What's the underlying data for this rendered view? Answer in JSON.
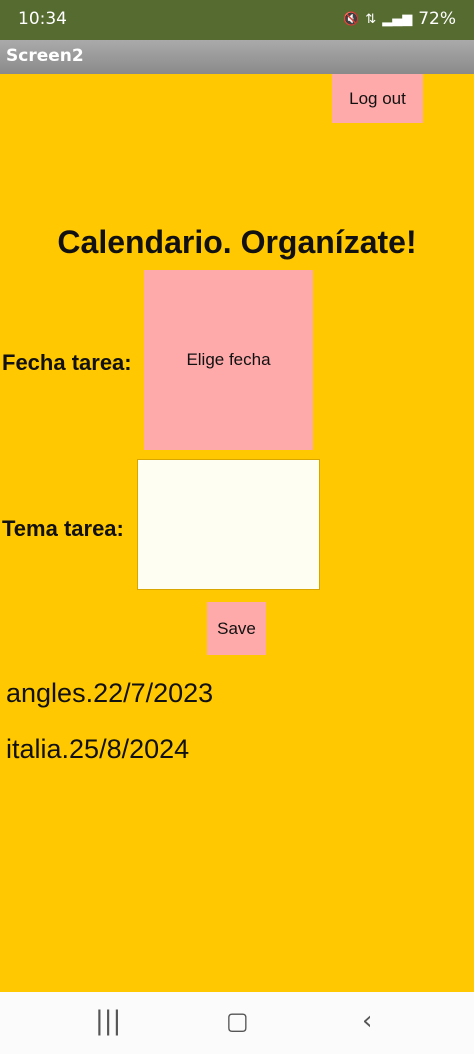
{
  "status": {
    "time": "10:34",
    "battery": "72%",
    "icons": [
      "mute-icon",
      "4g-data-icon",
      "signal-icon"
    ]
  },
  "app": {
    "title": "Screen2"
  },
  "header": {
    "logout_label": "Log out"
  },
  "main": {
    "title": "Calendario. Organízate!",
    "fecha_label": "Fecha tarea:",
    "date_button_label": "Elige fecha",
    "tema_label": "Tema tarea:",
    "tema_value": "",
    "save_label": "Save"
  },
  "tasks": [
    "angles.22/7/2023",
    "italia.25/8/2024"
  ],
  "nav": {
    "icons": [
      "recent-apps-icon",
      "home-icon",
      "back-icon"
    ]
  },
  "colors": {
    "background": "#ffc800",
    "button": "#ffaaaa",
    "statusbar": "#556b2f",
    "textarea": "#fffef2"
  }
}
